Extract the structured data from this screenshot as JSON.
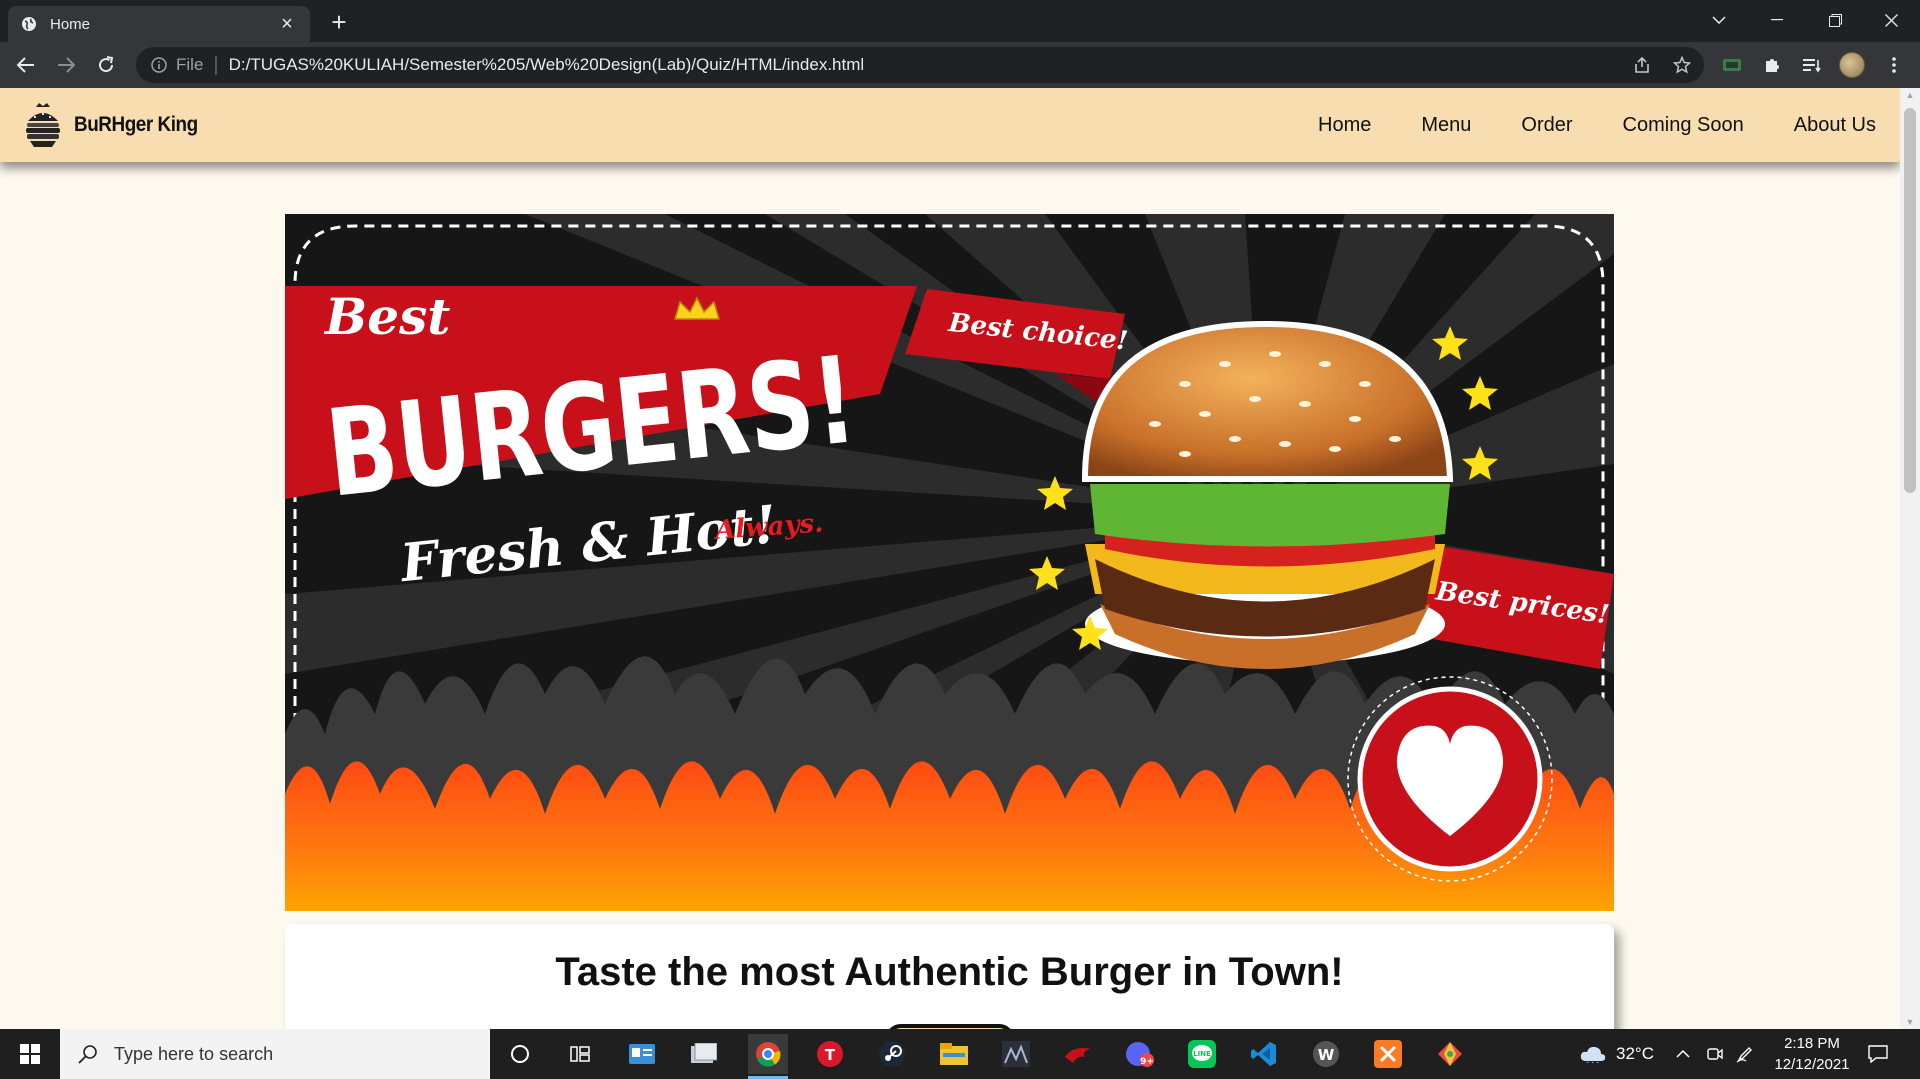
{
  "browser": {
    "tab_title": "Home",
    "url_scheme": "File",
    "url": "D:/TUGAS%20KULIAH/Semester%205/Web%20Design(Lab)/Quiz/HTML/index.html"
  },
  "site": {
    "brand_name": "BuRHger King",
    "nav": [
      "Home",
      "Menu",
      "Order",
      "Coming Soon",
      "About Us"
    ]
  },
  "hero": {
    "best": "Best",
    "burgers": "BURGERS!",
    "fresh": "Fresh & Hot!",
    "always": "Always.",
    "best_choice": "Best choice!",
    "best_prices": "Best prices!"
  },
  "card": {
    "title": "Taste the most Authentic Burger in Town!"
  },
  "taskbar": {
    "search_placeholder": "Type here to search",
    "weather": "32°C",
    "time": "2:18 PM",
    "date": "12/12/2021"
  },
  "colors": {
    "nav_bg": "#f7ddb0",
    "page_bg": "#fdf9ef",
    "ribbon_red": "#c8101a",
    "browser_dark": "#202124"
  }
}
